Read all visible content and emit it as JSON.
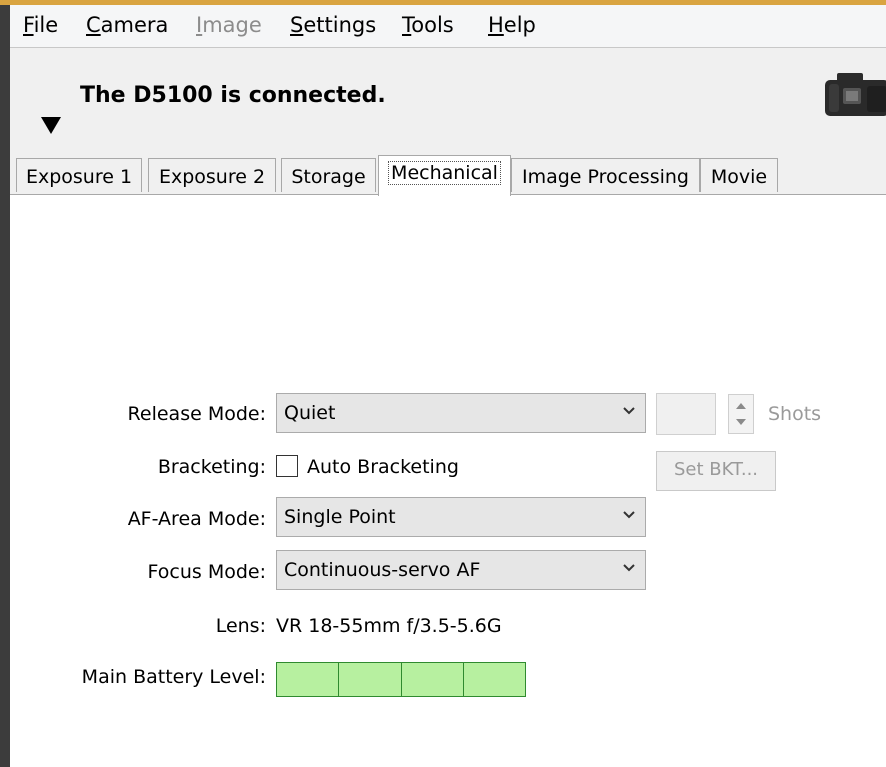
{
  "menu": [
    {
      "mnemonic": "F",
      "rest": "ile",
      "enabled": true
    },
    {
      "mnemonic": "C",
      "rest": "amera",
      "enabled": true
    },
    {
      "mnemonic": "I",
      "rest": "mage",
      "enabled": false
    },
    {
      "mnemonic": "S",
      "rest": "ettings",
      "enabled": true
    },
    {
      "mnemonic": "T",
      "rest": "ools",
      "enabled": true
    },
    {
      "mnemonic": "H",
      "rest": "elp",
      "enabled": true
    }
  ],
  "header": {
    "status_text": "The D5100 is connected.",
    "camera_icon": "camera-icon",
    "collapse_icon": "triangle-down-icon"
  },
  "tabs": [
    "Exposure 1",
    "Exposure 2",
    "Storage",
    "Mechanical",
    "Image Processing",
    "Movie"
  ],
  "active_tab": "Mechanical",
  "form": {
    "release_mode": {
      "label": "Release Mode:",
      "value": "Quiet"
    },
    "shots": {
      "value": "",
      "label": "Shots"
    },
    "bracketing": {
      "label": "Bracketing:",
      "checkbox_label": "Auto Bracketing",
      "checked": false
    },
    "set_bkt": {
      "label": "Set BKT..."
    },
    "af_area_mode": {
      "label": "AF-Area Mode:",
      "value": "Single Point"
    },
    "focus_mode": {
      "label": "Focus Mode:",
      "value": "Continuous-servo AF"
    },
    "lens": {
      "label": "Lens:",
      "value": "VR 18-55mm f/3.5-5.6G"
    },
    "battery": {
      "label": "Main Battery Level:",
      "segments_total": 4,
      "segments_filled": 4,
      "level_fraction": 1.0
    }
  },
  "colors": {
    "battery_fill": "#b7f0a0",
    "battery_border": "#2f8a2f",
    "window_bg": "#f0f0f0",
    "panel_bg": "#ffffff"
  }
}
